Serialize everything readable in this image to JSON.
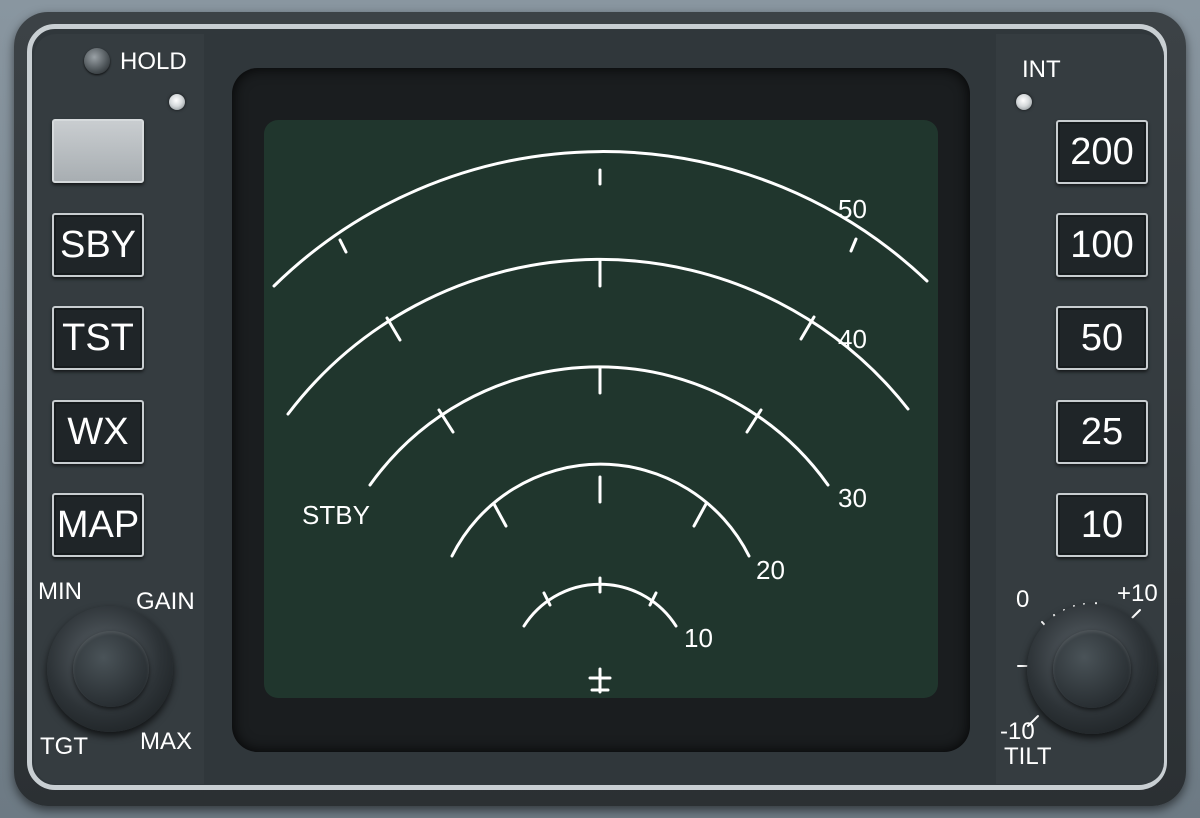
{
  "left_panel": {
    "hold_label": "HOLD",
    "buttons": [
      {
        "label": ""
      },
      {
        "label": "SBY"
      },
      {
        "label": "TST"
      },
      {
        "label": "WX"
      },
      {
        "label": "MAP"
      }
    ],
    "gain_knob": {
      "min_label": "MIN",
      "gain_label": "GAIN",
      "tgt_label": "TGT",
      "max_label": "MAX"
    }
  },
  "right_panel": {
    "int_label": "INT",
    "range_buttons": [
      {
        "label": "200"
      },
      {
        "label": "100"
      },
      {
        "label": "50"
      },
      {
        "label": "25"
      },
      {
        "label": "10"
      }
    ],
    "tilt_knob": {
      "zero_label": "0",
      "plus_label": "+10",
      "minus_label": "-10",
      "tilt_label": "TILT"
    }
  },
  "display": {
    "mode_text": "STBY",
    "range_rings": [
      {
        "label": "10"
      },
      {
        "label": "20"
      },
      {
        "label": "30"
      },
      {
        "label": "40"
      },
      {
        "label": "50"
      }
    ]
  },
  "colors": {
    "screen_background": "#20362d",
    "symbology": "#ffffff"
  }
}
